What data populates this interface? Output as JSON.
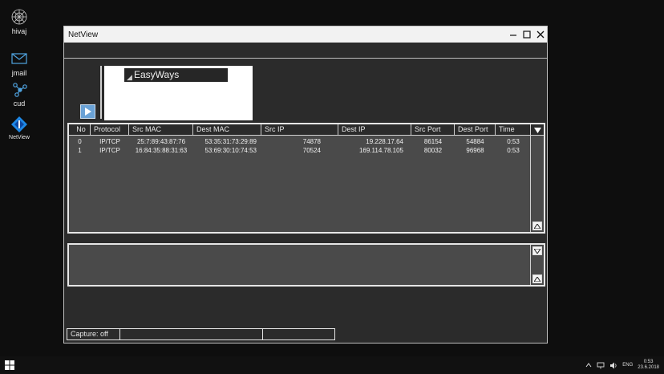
{
  "desktop": {
    "icons": [
      {
        "label": "hivaj",
        "icon": "web-icon"
      },
      {
        "label": "jmail",
        "icon": "mail-icon"
      },
      {
        "label": "cud",
        "icon": "network-nodes-icon"
      },
      {
        "label": "NetView",
        "icon": "netview-icon"
      }
    ]
  },
  "window": {
    "title": "NetView",
    "logo_text": "EasyWays",
    "table": {
      "columns": [
        "No",
        "Protocol",
        "Src MAC",
        "Dest MAC",
        "Src IP",
        "Dest IP",
        "Src Port",
        "Dest Port",
        "Time"
      ],
      "rows": [
        [
          "0",
          "IP/TCP",
          "25:7:89:43:87:76",
          "53:35:31:73:29:89",
          "74878",
          "19.228.17.64",
          "86154",
          "54884",
          "0:53"
        ],
        [
          "1",
          "IP/TCP",
          "16:84:35:88:31:63",
          "53:69:30:10:74:53",
          "70524",
          "169.114.78.105",
          "80032",
          "96968",
          "0:53"
        ]
      ]
    },
    "status": {
      "capture": "Capture: off",
      "cell2": "",
      "cell3": ""
    }
  },
  "taskbar": {
    "language": "ENG",
    "time": "0:53",
    "date": "23.6.2018"
  }
}
